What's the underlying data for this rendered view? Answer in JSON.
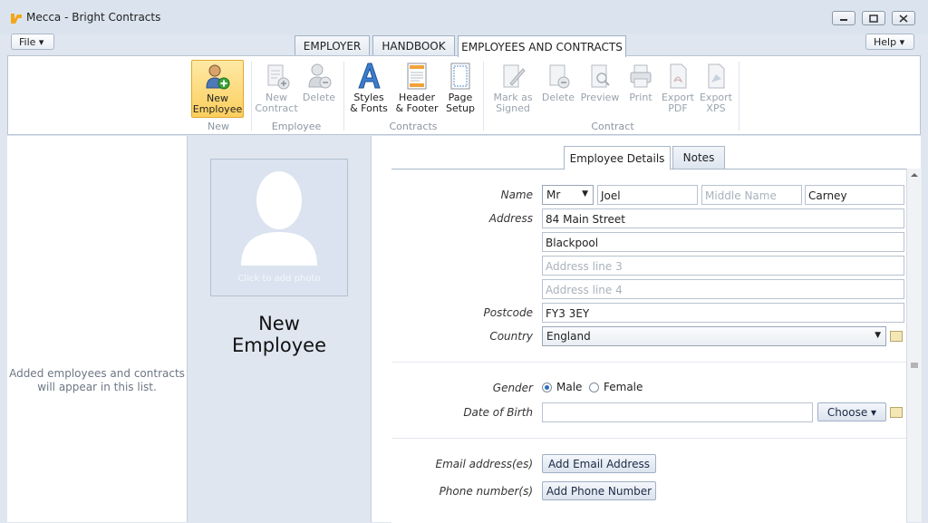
{
  "window": {
    "title": "Mecca - Bright Contracts"
  },
  "menu": {
    "file": "File ▾",
    "help": "Help ▾"
  },
  "tabs": [
    {
      "label": "EMPLOYER"
    },
    {
      "label": "HANDBOOK"
    },
    {
      "label": "EMPLOYEES AND CONTRACTS"
    }
  ],
  "ribbon": {
    "new_employee": [
      "New",
      "Employee"
    ],
    "new_contract": [
      "New",
      "Contract"
    ],
    "delete_employee": "Delete",
    "styles_fonts": [
      "Styles",
      "& Fonts"
    ],
    "header_footer": [
      "Header",
      "& Footer"
    ],
    "page_setup": [
      "Page",
      "Setup"
    ],
    "mark_signed": [
      "Mark as",
      "Signed"
    ],
    "delete_contract": "Delete",
    "preview": "Preview",
    "print": "Print",
    "export_pdf": [
      "Export",
      "PDF"
    ],
    "export_xps": [
      "Export",
      "XPS"
    ],
    "groups": {
      "new": "New",
      "employee": "Employee",
      "contracts": "Contracts",
      "contract": "Contract"
    }
  },
  "list": {
    "empty_line1": "Added employees and contracts",
    "empty_line2": "will appear in this list."
  },
  "photo": {
    "caption": "Click to add photo",
    "name_line1": "New",
    "name_line2": "Employee"
  },
  "form_tabs": {
    "details": "Employee Details",
    "notes": "Notes"
  },
  "form": {
    "labels": {
      "name": "Name",
      "address": "Address",
      "postcode": "Postcode",
      "country": "Country",
      "gender": "Gender",
      "dob": "Date of Birth",
      "email": "Email address(es)",
      "phone": "Phone number(s)"
    },
    "title": "Mr",
    "first_name": "Joel",
    "middle_name_placeholder": "Middle Name",
    "last_name": "Carney",
    "address1": "84 Main Street",
    "address2": "Blackpool",
    "address3_placeholder": "Address line 3",
    "address4_placeholder": "Address line 4",
    "postcode": "FY3 3EY",
    "country": "England",
    "gender_male": "Male",
    "gender_female": "Female",
    "gender_selected": "Male",
    "dob": "",
    "choose": "Choose ▾",
    "add_email": "Add Email Address",
    "add_phone": "Add Phone Number"
  }
}
